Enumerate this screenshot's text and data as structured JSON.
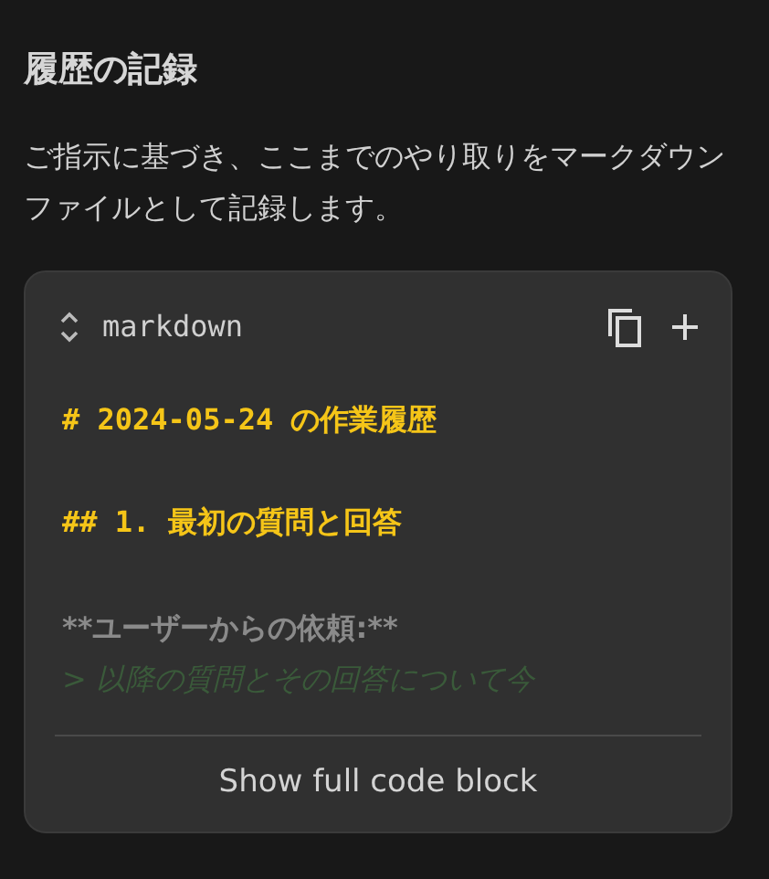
{
  "heading": "履歴の記録",
  "paragraph": "ご指示に基づき、ここまでのやり取りをマークダウンファイルとして記録します。",
  "code_block": {
    "language": "markdown",
    "lines": [
      {
        "kind": "h1",
        "text": "# 2024-05-24 の作業履歴"
      },
      {
        "kind": "h2",
        "text": "## 1. 最初の質問と回答"
      },
      {
        "kind": "bold",
        "text": "**ユーザーからの依頼:**"
      },
      {
        "kind": "quote",
        "text": "> 以降の質問とその回答について今"
      }
    ],
    "expand_label": "Show full code block"
  }
}
